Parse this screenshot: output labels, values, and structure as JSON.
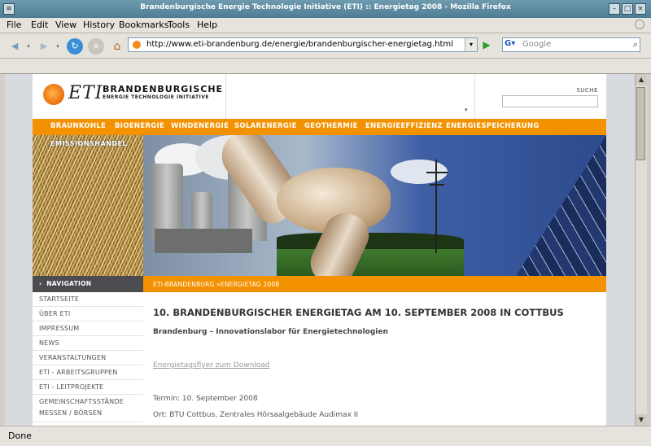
{
  "window": {
    "title": "Brandenburgische Energie Technologie Initiative (ETI) :: Energietag 2008 - Mozilla Firefox"
  },
  "menu": [
    {
      "label": "File"
    },
    {
      "label": "Edit"
    },
    {
      "label": "View"
    },
    {
      "label": "History"
    },
    {
      "label": "Bookmarks"
    },
    {
      "label": "Tools"
    },
    {
      "label": "Help"
    }
  ],
  "toolbar": {
    "url": "http://www.eti-brandenburg.de/energie/brandenburgischer-energietag.html",
    "search_placeholder": "Google"
  },
  "status": {
    "text": "Done"
  },
  "site": {
    "logo_mark": "ETI",
    "logo_name": "BRANDENBURGISCHE",
    "logo_sub": "ENERGIE TECHNOLOGIE INITIATIVE",
    "search_label": "SUCHE",
    "accent": "#f39200",
    "topnav": [
      "BRAUNKOHLE",
      "BIOENERGIE",
      "WINDENERGIE",
      "SOLARENERGIE",
      "GEOTHERMIE",
      "ENERGIEEFFIZIENZ",
      "ENERGIESPEICHERUNG"
    ],
    "banner_label": "EMISSIONSHANDEL",
    "nav_title": "NAVIGATION",
    "nav_items": [
      "STARTSEITE",
      "ÜBER ETI",
      "IMPRESSUM",
      "NEWS",
      "VERANSTALTUNGEN",
      "ETI - ARBEITSGRUPPEN",
      "ETI - LEITPROJEKTE",
      "GEMEINSCHAFTSSTÄNDE",
      "MESSEN / BÖRSEN"
    ],
    "breadcrumb": "ETI-BRANDENBURG  »ENERGIETAG 2008",
    "heading": "10. BRANDENBURGISCHER ENERGIETAG AM 10. SEPTEMBER 2008 IN COTTBUS",
    "subheading": "Brandenburg – Innovationslabor für Energietechnologien",
    "download_link": "Energietagsflyer zum Download",
    "date_line": "Termin: 10. September 2008",
    "place_line": "Ort: BTU Cottbus, Zentrales Hörsaalgebäude Audimax II"
  }
}
